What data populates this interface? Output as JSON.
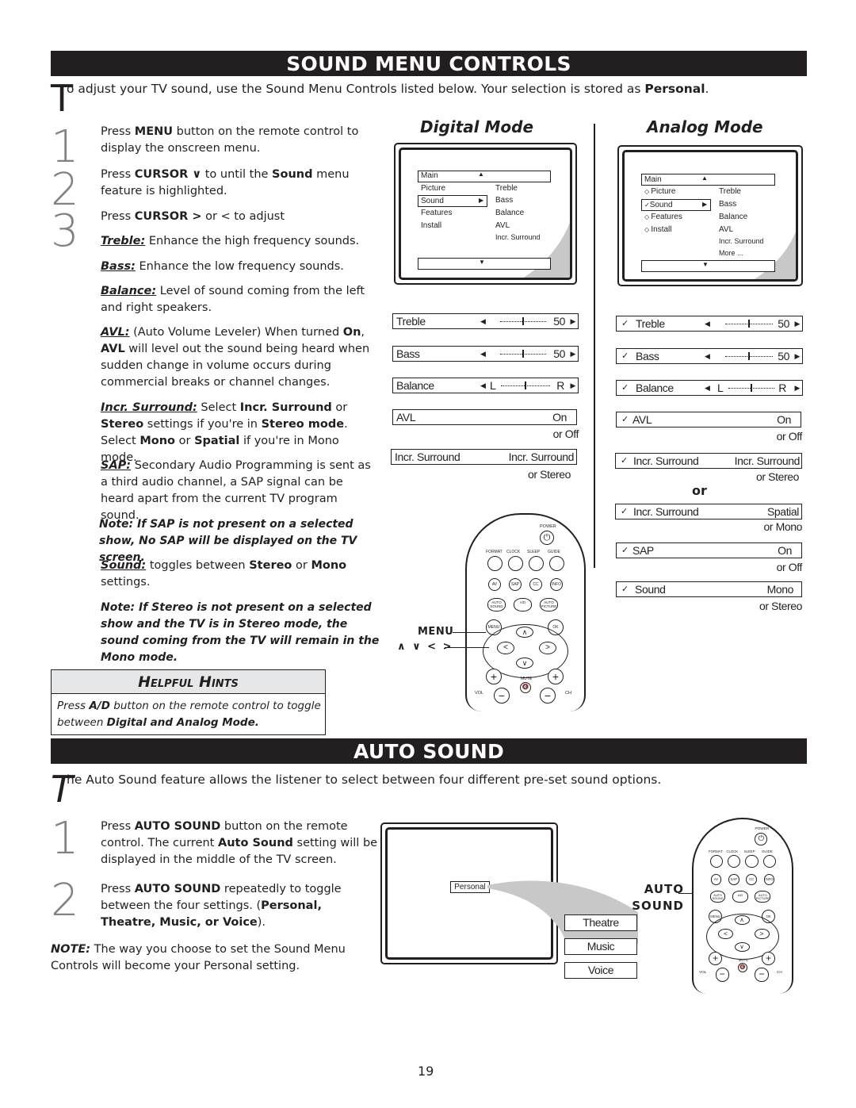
{
  "page_number": "19",
  "sound_menu": {
    "title": "SOUND MENU CONTROLS",
    "intro_dropcap": "T",
    "intro_text": "o adjust your TV sound, use the Sound Menu Controls listed below.  Your selection is stored as ",
    "intro_bold": "Personal",
    "intro_end": ".",
    "steps": [
      {
        "num": "1",
        "parts": [
          "Press ",
          "MENU",
          " button on the remote control to display the onscreen menu."
        ]
      },
      {
        "num": "2",
        "parts": [
          "Press ",
          "CURSOR  ∨",
          " to until the ",
          "Sound",
          " menu feature is highlighted."
        ]
      },
      {
        "num": "3",
        "parts": [
          "Press ",
          "CURSOR  >",
          "  or  < to adjust"
        ]
      }
    ],
    "definitions": {
      "treble_term": "Treble:",
      "treble_text": " Enhance the high frequency sounds.",
      "bass_term": "Bass:",
      "bass_text": "   Enhance the low frequency sounds.",
      "balance_term": "Balance:",
      "balance_text": "   Level of sound coming from the left and right speakers.",
      "avl_term": "AVL:",
      "avl_text1": "  (Auto Volume Leveler)  When turned ",
      "avl_on": "On",
      "avl_comma": ", ",
      "avl_bold": "AVL",
      "avl_text2": " will level out the sound being heard when sudden change in volume occurs during commercial breaks or channel changes.",
      "surround_term": "Incr. Surround:",
      "surround_t1": "  Select ",
      "surround_b1": "Incr. Surround",
      "surround_t2": " or ",
      "surround_b2": "Stereo",
      "surround_t3": " settings if you're in ",
      "surround_b3": "Stereo mode",
      "surround_t4": ". Select ",
      "surround_b4": "Mono",
      "surround_t5": " or ",
      "surround_b5": "Spatial",
      "surround_t6": " if you're in Mono mode.",
      "sap_term": "SAP:",
      "sap_text": "  Secondary Audio Programming is sent as a third audio channel, a SAP signal can be heard apart from the current TV program sound.",
      "sap_note": "Note:  If SAP is not present on a selected show, No SAP will be displayed on the TV screen.",
      "sound_term": "Sound:",
      "sound_t1": " toggles between ",
      "sound_b1": "Stereo",
      "sound_t2": " or ",
      "sound_b2": "Mono",
      "sound_t3": " settings.",
      "stereo_note": "Note: If  Stereo is not present on a selected show and the TV is in Stereo mode, the sound coming from the TV will remain in the Mono mode."
    },
    "helpful_hints": {
      "title": "Helpful Hints",
      "t1": "Press ",
      "b1": "A/D",
      "t2": " button on the remote control to toggle between ",
      "b2": "Digital and Analog Mode."
    },
    "digital": {
      "title": "Digital Mode",
      "menu": {
        "header": "Main",
        "left": [
          "Picture",
          "Sound",
          "Features",
          "Install"
        ],
        "right": [
          "Treble",
          "Bass",
          "Balance",
          "AVL",
          "Incr. Surround"
        ],
        "selected": "Sound"
      },
      "osd": [
        {
          "label": "Treble",
          "value": "50",
          "slider": 0.5
        },
        {
          "label": "Bass",
          "value": "50",
          "slider": 0.5
        },
        {
          "label": "Balance",
          "left": "L",
          "right": "R",
          "slider": 0.5
        },
        {
          "label": "AVL",
          "value": "On",
          "alt": "or Off"
        },
        {
          "label": "Incr. Surround",
          "value": "Incr. Surround",
          "alt": "or Stereo"
        }
      ]
    },
    "analog": {
      "title": "Analog Mode",
      "menu": {
        "header": "Main",
        "left": [
          "Picture",
          "Sound",
          "Features",
          "Install"
        ],
        "right": [
          "Treble",
          "Bass",
          "Balance",
          "AVL",
          "Incr. Surround",
          "More ..."
        ],
        "selected": "Sound"
      },
      "osd": [
        {
          "label": "Treble",
          "value": "50",
          "slider": 0.5
        },
        {
          "label": "Bass",
          "value": "50",
          "slider": 0.5
        },
        {
          "label": "Balance",
          "left": "L",
          "right": "R",
          "slider": 0.5
        },
        {
          "label": "AVL",
          "value": "On",
          "alt": "or Off"
        },
        {
          "label": "Incr. Surround",
          "value": "Incr. Surround",
          "alt": "or Stereo"
        },
        {
          "label": "Incr. Surround",
          "value": "Spatial",
          "alt": "or Mono"
        },
        {
          "label": "SAP",
          "value": "On",
          "alt": "or Off"
        },
        {
          "label": "Sound",
          "value": "Mono",
          "alt": "or Stereo"
        }
      ],
      "or_separator": "or"
    },
    "remote_callouts": {
      "menu": "MENU",
      "cursor": "∧  ∨  <  >"
    }
  },
  "remote": {
    "power": "POWER",
    "row1": [
      "FORMAT",
      "CLOCK",
      "SLEEP",
      "GUIDE"
    ],
    "row2": [
      "AV",
      "SAP",
      "CC",
      "INFO"
    ],
    "row3": [
      "AUTO SOUND",
      "A/D",
      "AUTO PICTURE"
    ],
    "menu": "MENU",
    "ok": "OK",
    "mute": "MUTE",
    "vol": "VOL",
    "ch": "CH"
  },
  "auto_sound": {
    "title": "AUTO SOUND",
    "intro_dropcap": "T",
    "intro_text": "he Auto Sound feature allows the listener to select between four different pre-set sound options.",
    "steps": [
      {
        "num": "1",
        "parts": [
          "Press ",
          "AUTO SOUND",
          " button on the remote control. The current ",
          "Auto Sound",
          " setting will be displayed in the middle of the TV screen."
        ]
      },
      {
        "num": "2",
        "parts": [
          "Press ",
          "AUTO  SOUND",
          " repeatedly to toggle between the four settings. (",
          "Personal, Theatre, Music, or Voice",
          ")."
        ]
      }
    ],
    "note_label": "NOTE:",
    "note_text": " The way you choose to set the Sound Menu Controls will become your Personal setting.",
    "tv_current": "Personal",
    "options": [
      "Theatre",
      "Music",
      "Voice"
    ],
    "callout": "AUTO SOUND"
  }
}
